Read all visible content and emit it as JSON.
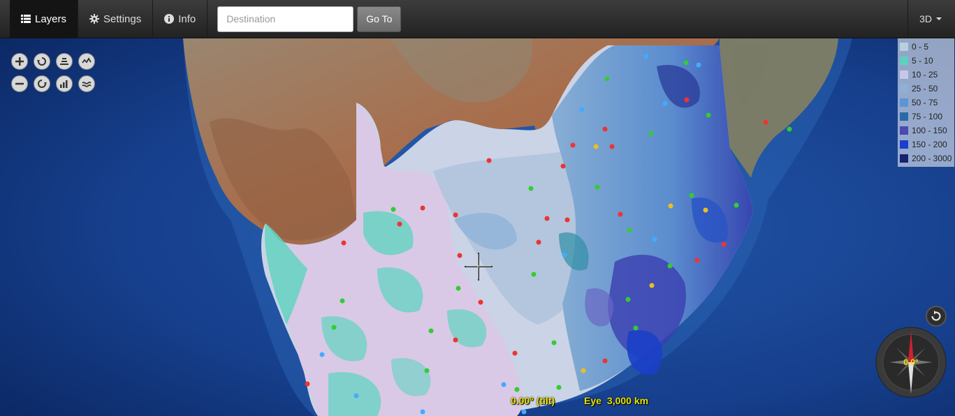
{
  "navbar": {
    "tabs": [
      {
        "label": "Layers",
        "icon": "list-icon",
        "active": true
      },
      {
        "label": "Settings",
        "icon": "gear-icon",
        "active": false
      },
      {
        "label": "Info",
        "icon": "info-icon",
        "active": false
      }
    ],
    "destination_placeholder": "Destination",
    "destination_value": "",
    "goto_label": "Go To",
    "mode_label": "3D"
  },
  "legend": {
    "items": [
      {
        "label": "0 - 5",
        "color": "#b8cfe0"
      },
      {
        "label": "5 - 10",
        "color": "#5fd0c0"
      },
      {
        "label": "10 - 25",
        "color": "#c6c8ea"
      },
      {
        "label": "25 - 50",
        "color": "#8fb0d8"
      },
      {
        "label": "50 - 75",
        "color": "#5b95d6"
      },
      {
        "label": "75 - 100",
        "color": "#2a6aa6"
      },
      {
        "label": "100 - 150",
        "color": "#4a4ab2"
      },
      {
        "label": "150 - 200",
        "color": "#1a3fd0"
      },
      {
        "label": "200 - 3000",
        "color": "#142470"
      }
    ]
  },
  "status": {
    "tilt": "0.00° (tilt)",
    "eye_label": "Eye",
    "eye_value": "3,000 km"
  },
  "compass": {
    "heading": "0.0°"
  },
  "tools": [
    {
      "name": "zoom-in-icon"
    },
    {
      "name": "rotate-left-icon"
    },
    {
      "name": "tilt-up-icon"
    },
    {
      "name": "exaggeration-up-icon"
    },
    {
      "name": "zoom-out-icon"
    },
    {
      "name": "rotate-right-icon"
    },
    {
      "name": "tilt-down-icon"
    },
    {
      "name": "exaggeration-down-icon"
    }
  ]
}
